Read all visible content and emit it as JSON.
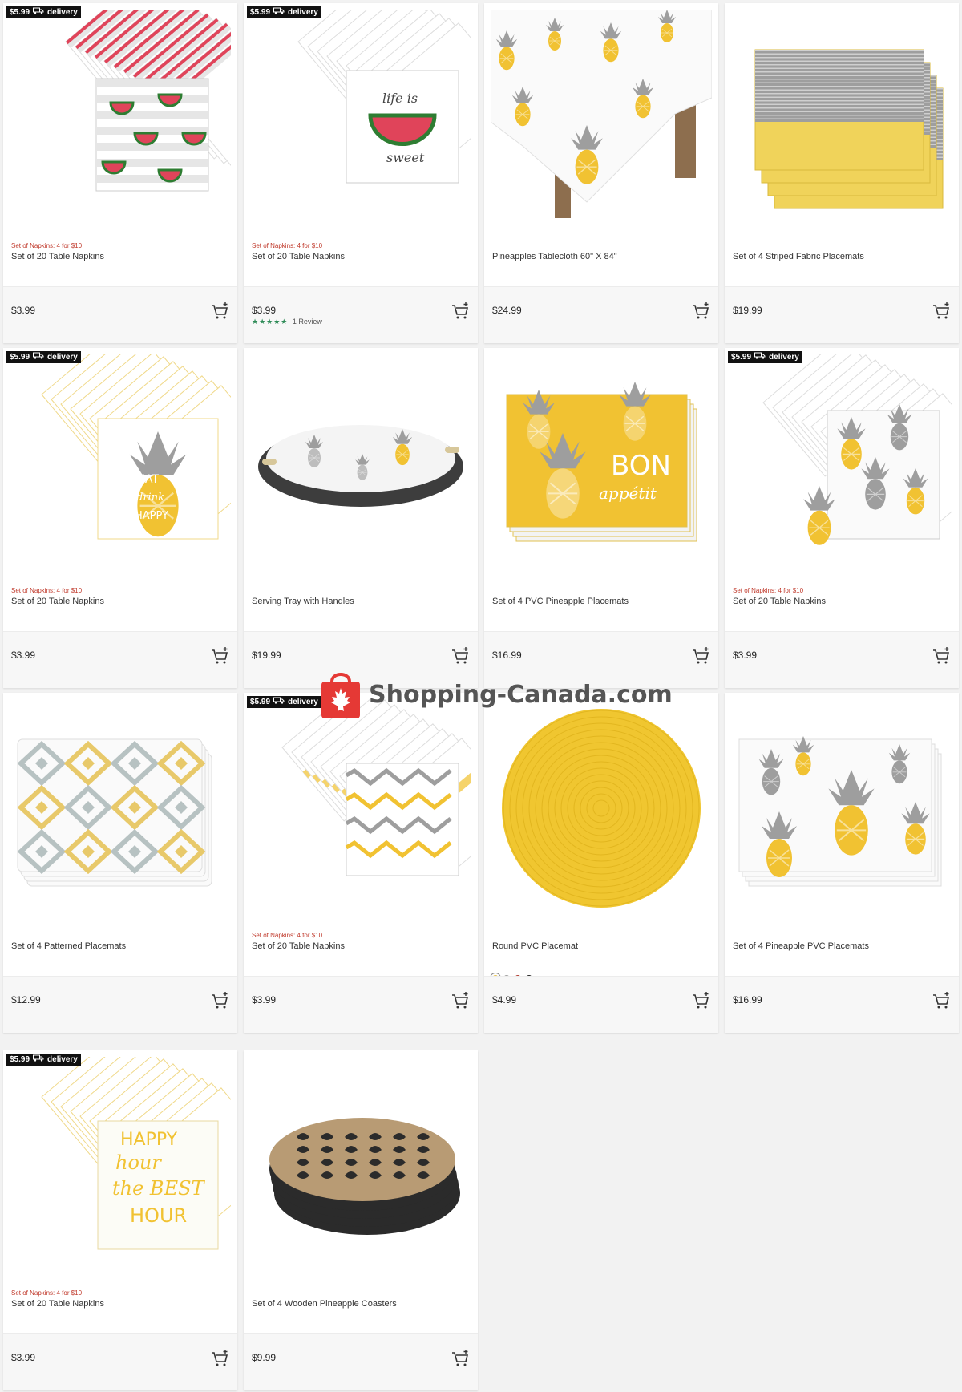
{
  "badge": {
    "price": "$5.99",
    "label": "delivery"
  },
  "watermark": {
    "text": "Shopping-Canada.com"
  },
  "colors": {
    "promo": "#c0392b",
    "stars": "#2e8b57",
    "yellow": "#f1c232",
    "watermelon": "#e0445a"
  },
  "products": [
    {
      "badge": true,
      "promo": "Set of Napkins: 4 for $10",
      "name": "Set of 20 Table Napkins",
      "price": "$3.99",
      "image": "watermelon-napkins-icon"
    },
    {
      "badge": true,
      "promo": "Set of Napkins: 4 for $10",
      "name": "Set of 20 Table Napkins",
      "price": "$3.99",
      "stars": "★★★★★",
      "reviews": "1 Review",
      "image": "life-is-sweet-napkins-icon"
    },
    {
      "badge": false,
      "promo": "",
      "name": "Pineapples Tablecloth 60\" X 84\"",
      "price": "$24.99",
      "image": "pineapple-tablecloth-icon"
    },
    {
      "badge": false,
      "promo": "",
      "name": "Set of 4 Striped Fabric Placemats",
      "price": "$19.99",
      "image": "striped-placemats-icon"
    },
    {
      "badge": true,
      "promo": "Set of Napkins: 4 for $10",
      "name": "Set of 20 Table Napkins",
      "price": "$3.99",
      "image": "eat-drink-napkins-icon"
    },
    {
      "badge": false,
      "promo": "",
      "name": "Serving Tray with Handles",
      "price": "$19.99",
      "image": "serving-tray-icon"
    },
    {
      "badge": false,
      "promo": "",
      "name": "Set of 4 PVC Pineapple Placemats",
      "price": "$16.99",
      "image": "bon-appetit-placemats-icon"
    },
    {
      "badge": true,
      "promo": "Set of Napkins: 4 for $10",
      "name": "Set of 20 Table Napkins",
      "price": "$3.99",
      "image": "pineapple-napkins-icon"
    },
    {
      "badge": false,
      "promo": "",
      "name": "Set of 4 Patterned Placemats",
      "price": "$12.99",
      "image": "patterned-placemats-icon"
    },
    {
      "badge": true,
      "promo": "Set of Napkins: 4 for $10",
      "name": "Set of 20 Table Napkins",
      "price": "$3.99",
      "image": "geometric-napkins-icon"
    },
    {
      "badge": false,
      "promo": "",
      "name": "Round PVC Placemat",
      "price": "$4.99",
      "image": "round-placemat-icon",
      "swatches": [
        "#e8c24a",
        "#9e9e9e",
        "#b03a2e",
        "#222222"
      ]
    },
    {
      "badge": false,
      "promo": "",
      "name": "Set of 4 Pineapple PVC Placemats",
      "price": "$16.99",
      "image": "pineapple-pvc-placemats-icon"
    },
    {
      "badge": true,
      "promo": "Set of Napkins: 4 for $10",
      "name": "Set of 20 Table Napkins",
      "price": "$3.99",
      "image": "happy-hour-napkins-icon"
    },
    {
      "badge": false,
      "promo": "",
      "name": "Set of 4 Wooden Pineapple Coasters",
      "price": "$9.99",
      "image": "wooden-coasters-icon"
    }
  ]
}
